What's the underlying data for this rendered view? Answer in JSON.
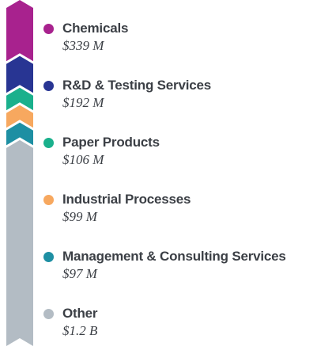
{
  "chart_data": {
    "type": "bar",
    "stacked": true,
    "orientation": "vertical",
    "legend": "right",
    "categories": [
      "Chemicals",
      "R&D & Testing Services",
      "Paper Products",
      "Industrial Processes",
      "Management & Consulting Services",
      "Other"
    ],
    "value_labels": [
      "$339 M",
      "$192 M",
      "$106 M",
      "$99 M",
      "$97 M",
      "$1.2 B"
    ],
    "values": [
      339,
      192,
      106,
      99,
      97,
      1200
    ],
    "unit": "$M",
    "colors": [
      "#a8228e",
      "#283593",
      "#1ab08c",
      "#f7a85f",
      "#1e8fa3",
      "#b3bcc4"
    ]
  }
}
